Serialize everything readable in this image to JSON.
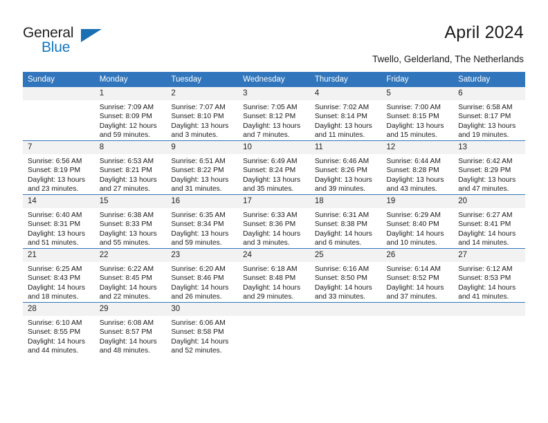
{
  "brand": {
    "name_part1": "General",
    "name_part2": "Blue"
  },
  "header": {
    "title": "April 2024",
    "subtitle": "Twello, Gelderland, The Netherlands"
  },
  "colors": {
    "header_blue": "#3176bc",
    "logo_blue": "#1277bf",
    "daynum_bg": "#f2f2f2",
    "text": "#1a1a1a"
  },
  "weekdays": [
    "Sunday",
    "Monday",
    "Tuesday",
    "Wednesday",
    "Thursday",
    "Friday",
    "Saturday"
  ],
  "labels": {
    "sunrise_prefix": "Sunrise:",
    "sunset_prefix": "Sunset:",
    "daylight_prefix": "Daylight:"
  },
  "weeks": [
    [
      {
        "day": "",
        "empty": true
      },
      {
        "day": "1",
        "line1": "Sunrise: 7:09 AM",
        "line2": "Sunset: 8:09 PM",
        "line3": "Daylight: 12 hours",
        "line4": "and 59 minutes."
      },
      {
        "day": "2",
        "line1": "Sunrise: 7:07 AM",
        "line2": "Sunset: 8:10 PM",
        "line3": "Daylight: 13 hours",
        "line4": "and 3 minutes."
      },
      {
        "day": "3",
        "line1": "Sunrise: 7:05 AM",
        "line2": "Sunset: 8:12 PM",
        "line3": "Daylight: 13 hours",
        "line4": "and 7 minutes."
      },
      {
        "day": "4",
        "line1": "Sunrise: 7:02 AM",
        "line2": "Sunset: 8:14 PM",
        "line3": "Daylight: 13 hours",
        "line4": "and 11 minutes."
      },
      {
        "day": "5",
        "line1": "Sunrise: 7:00 AM",
        "line2": "Sunset: 8:15 PM",
        "line3": "Daylight: 13 hours",
        "line4": "and 15 minutes."
      },
      {
        "day": "6",
        "line1": "Sunrise: 6:58 AM",
        "line2": "Sunset: 8:17 PM",
        "line3": "Daylight: 13 hours",
        "line4": "and 19 minutes."
      }
    ],
    [
      {
        "day": "7",
        "line1": "Sunrise: 6:56 AM",
        "line2": "Sunset: 8:19 PM",
        "line3": "Daylight: 13 hours",
        "line4": "and 23 minutes."
      },
      {
        "day": "8",
        "line1": "Sunrise: 6:53 AM",
        "line2": "Sunset: 8:21 PM",
        "line3": "Daylight: 13 hours",
        "line4": "and 27 minutes."
      },
      {
        "day": "9",
        "line1": "Sunrise: 6:51 AM",
        "line2": "Sunset: 8:22 PM",
        "line3": "Daylight: 13 hours",
        "line4": "and 31 minutes."
      },
      {
        "day": "10",
        "line1": "Sunrise: 6:49 AM",
        "line2": "Sunset: 8:24 PM",
        "line3": "Daylight: 13 hours",
        "line4": "and 35 minutes."
      },
      {
        "day": "11",
        "line1": "Sunrise: 6:46 AM",
        "line2": "Sunset: 8:26 PM",
        "line3": "Daylight: 13 hours",
        "line4": "and 39 minutes."
      },
      {
        "day": "12",
        "line1": "Sunrise: 6:44 AM",
        "line2": "Sunset: 8:28 PM",
        "line3": "Daylight: 13 hours",
        "line4": "and 43 minutes."
      },
      {
        "day": "13",
        "line1": "Sunrise: 6:42 AM",
        "line2": "Sunset: 8:29 PM",
        "line3": "Daylight: 13 hours",
        "line4": "and 47 minutes."
      }
    ],
    [
      {
        "day": "14",
        "line1": "Sunrise: 6:40 AM",
        "line2": "Sunset: 8:31 PM",
        "line3": "Daylight: 13 hours",
        "line4": "and 51 minutes."
      },
      {
        "day": "15",
        "line1": "Sunrise: 6:38 AM",
        "line2": "Sunset: 8:33 PM",
        "line3": "Daylight: 13 hours",
        "line4": "and 55 minutes."
      },
      {
        "day": "16",
        "line1": "Sunrise: 6:35 AM",
        "line2": "Sunset: 8:34 PM",
        "line3": "Daylight: 13 hours",
        "line4": "and 59 minutes."
      },
      {
        "day": "17",
        "line1": "Sunrise: 6:33 AM",
        "line2": "Sunset: 8:36 PM",
        "line3": "Daylight: 14 hours",
        "line4": "and 3 minutes."
      },
      {
        "day": "18",
        "line1": "Sunrise: 6:31 AM",
        "line2": "Sunset: 8:38 PM",
        "line3": "Daylight: 14 hours",
        "line4": "and 6 minutes."
      },
      {
        "day": "19",
        "line1": "Sunrise: 6:29 AM",
        "line2": "Sunset: 8:40 PM",
        "line3": "Daylight: 14 hours",
        "line4": "and 10 minutes."
      },
      {
        "day": "20",
        "line1": "Sunrise: 6:27 AM",
        "line2": "Sunset: 8:41 PM",
        "line3": "Daylight: 14 hours",
        "line4": "and 14 minutes."
      }
    ],
    [
      {
        "day": "21",
        "line1": "Sunrise: 6:25 AM",
        "line2": "Sunset: 8:43 PM",
        "line3": "Daylight: 14 hours",
        "line4": "and 18 minutes."
      },
      {
        "day": "22",
        "line1": "Sunrise: 6:22 AM",
        "line2": "Sunset: 8:45 PM",
        "line3": "Daylight: 14 hours",
        "line4": "and 22 minutes."
      },
      {
        "day": "23",
        "line1": "Sunrise: 6:20 AM",
        "line2": "Sunset: 8:46 PM",
        "line3": "Daylight: 14 hours",
        "line4": "and 26 minutes."
      },
      {
        "day": "24",
        "line1": "Sunrise: 6:18 AM",
        "line2": "Sunset: 8:48 PM",
        "line3": "Daylight: 14 hours",
        "line4": "and 29 minutes."
      },
      {
        "day": "25",
        "line1": "Sunrise: 6:16 AM",
        "line2": "Sunset: 8:50 PM",
        "line3": "Daylight: 14 hours",
        "line4": "and 33 minutes."
      },
      {
        "day": "26",
        "line1": "Sunrise: 6:14 AM",
        "line2": "Sunset: 8:52 PM",
        "line3": "Daylight: 14 hours",
        "line4": "and 37 minutes."
      },
      {
        "day": "27",
        "line1": "Sunrise: 6:12 AM",
        "line2": "Sunset: 8:53 PM",
        "line3": "Daylight: 14 hours",
        "line4": "and 41 minutes."
      }
    ],
    [
      {
        "day": "28",
        "line1": "Sunrise: 6:10 AM",
        "line2": "Sunset: 8:55 PM",
        "line3": "Daylight: 14 hours",
        "line4": "and 44 minutes."
      },
      {
        "day": "29",
        "line1": "Sunrise: 6:08 AM",
        "line2": "Sunset: 8:57 PM",
        "line3": "Daylight: 14 hours",
        "line4": "and 48 minutes."
      },
      {
        "day": "30",
        "line1": "Sunrise: 6:06 AM",
        "line2": "Sunset: 8:58 PM",
        "line3": "Daylight: 14 hours",
        "line4": "and 52 minutes."
      },
      {
        "day": "",
        "empty": true
      },
      {
        "day": "",
        "empty": true
      },
      {
        "day": "",
        "empty": true
      },
      {
        "day": "",
        "empty": true
      }
    ]
  ]
}
